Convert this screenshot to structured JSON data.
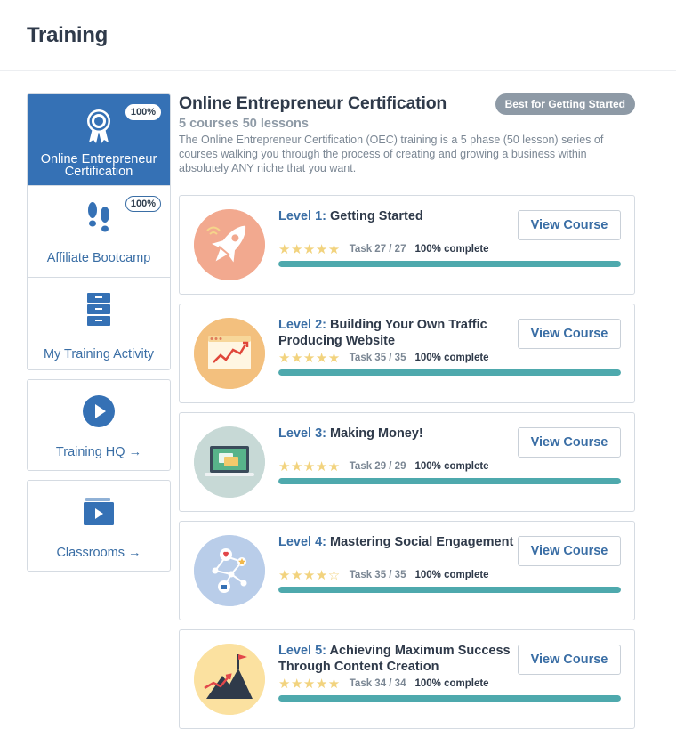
{
  "header": {
    "title": "Training"
  },
  "sidebar": {
    "items": [
      {
        "label": "Online Entrepreneur Certification",
        "badge": "100%",
        "icon": "award-ribbon-icon"
      },
      {
        "label": "Affiliate Bootcamp",
        "badge": "100%",
        "icon": "footprints-icon"
      },
      {
        "label": "My Training Activity",
        "icon": "file-cabinet-icon"
      },
      {
        "label": "Training HQ →",
        "icon": "play-circle-icon"
      },
      {
        "label": "Classrooms →",
        "icon": "video-folder-icon"
      }
    ]
  },
  "main": {
    "title": "Online Entrepreneur Certification",
    "badge": "Best for Getting Started",
    "subtitle": "5 courses 50 lessons",
    "description": "The Online Entrepreneur Certification (OEC) training is a 5 phase (50 lesson) series of courses walking you through the process of creating and growing a business within absolutely ANY niche that you want.",
    "button_label": "View Course",
    "courses": [
      {
        "level": "Level 1:",
        "name": "Getting Started",
        "stars": "★★★★★",
        "task": "Task 27 / 27",
        "complete": "100% complete",
        "progress": 1.0,
        "icon": "rocket-icon",
        "icon_bg": "#f2a98f"
      },
      {
        "level": "Level 2:",
        "name": "Building Your Own Traffic Producing Website",
        "stars": "★★★★★",
        "task": "Task 35 / 35",
        "complete": "100% complete",
        "progress": 1.0,
        "icon": "website-chart-icon",
        "icon_bg": "#f3c07e"
      },
      {
        "level": "Level 3:",
        "name": "Making Money!",
        "stars": "★★★★★",
        "task": "Task 29 / 29",
        "complete": "100% complete",
        "progress": 1.0,
        "icon": "laptop-payment-icon",
        "icon_bg": "#c7d9d6"
      },
      {
        "level": "Level 4:",
        "name": "Mastering Social Engagement",
        "stars": "★★★★☆",
        "task": "Task 35 / 35",
        "complete": "100% complete",
        "progress": 1.0,
        "icon": "social-network-icon",
        "icon_bg": "#b9cde9"
      },
      {
        "level": "Level 5:",
        "name": "Achieving Maximum Success Through Content Creation",
        "stars": "★★★★★",
        "task": "Task 34 / 34",
        "complete": "100% complete",
        "progress": 1.0,
        "icon": "mountain-flag-icon",
        "icon_bg": "#fbe1a0"
      }
    ]
  },
  "colors": {
    "accent": "#3571b5",
    "progress": "#4ea9ad",
    "star": "#f2d37e",
    "badge_bg": "#8e9aa6"
  }
}
